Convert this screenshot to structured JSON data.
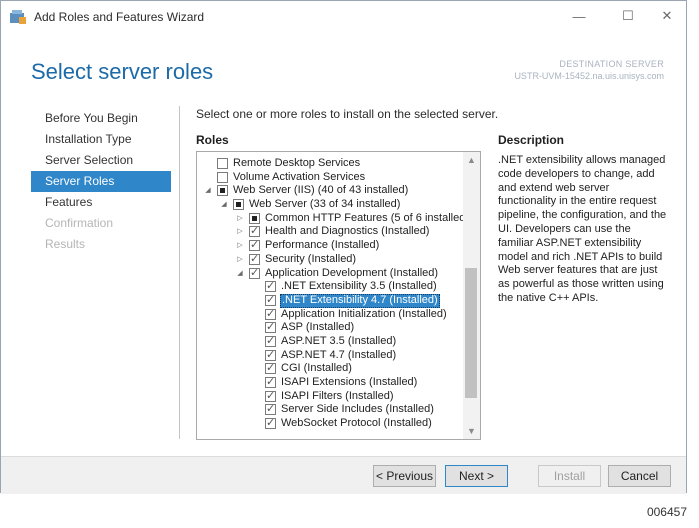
{
  "window": {
    "title": "Add Roles and Features Wizard",
    "controls": {
      "minimize": "—",
      "maximize": "☐",
      "close": "✕"
    }
  },
  "header": {
    "page_title": "Select server roles",
    "destination_label": "DESTINATION SERVER",
    "destination_server": "USTR-UVM-15452.na.uis.unisys.com"
  },
  "nav": {
    "items": [
      {
        "label": "Before You Begin",
        "state": "normal"
      },
      {
        "label": "Installation Type",
        "state": "normal"
      },
      {
        "label": "Server Selection",
        "state": "normal"
      },
      {
        "label": "Server Roles",
        "state": "active"
      },
      {
        "label": "Features",
        "state": "normal"
      },
      {
        "label": "Confirmation",
        "state": "disabled"
      },
      {
        "label": "Results",
        "state": "disabled"
      }
    ]
  },
  "main": {
    "instruction": "Select one or more roles to install on the selected server.",
    "roles_label": "Roles",
    "roles": [
      {
        "label": "Remote Desktop Services",
        "level": 0,
        "expander": "none",
        "check": "unchecked",
        "selected": false
      },
      {
        "label": "Volume Activation Services",
        "level": 0,
        "expander": "none",
        "check": "unchecked",
        "selected": false
      },
      {
        "label": "Web Server (IIS) (40 of 43 installed)",
        "level": 0,
        "expander": "expanded",
        "check": "partial",
        "selected": false
      },
      {
        "label": "Web Server (33 of 34 installed)",
        "level": 1,
        "expander": "expanded",
        "check": "partial",
        "selected": false
      },
      {
        "label": "Common HTTP Features (5 of 6 installed)",
        "level": 2,
        "expander": "collapsed",
        "check": "partial",
        "selected": false
      },
      {
        "label": "Health and Diagnostics (Installed)",
        "level": 2,
        "expander": "collapsed",
        "check": "checked",
        "selected": false
      },
      {
        "label": "Performance (Installed)",
        "level": 2,
        "expander": "collapsed",
        "check": "checked",
        "selected": false
      },
      {
        "label": "Security (Installed)",
        "level": 2,
        "expander": "collapsed",
        "check": "checked",
        "selected": false
      },
      {
        "label": "Application Development (Installed)",
        "level": 2,
        "expander": "expanded",
        "check": "checked",
        "selected": false
      },
      {
        "label": ".NET Extensibility 3.5 (Installed)",
        "level": 3,
        "expander": "none",
        "check": "checked",
        "selected": false
      },
      {
        "label": ".NET Extensibility 4.7 (Installed)",
        "level": 3,
        "expander": "none",
        "check": "checked",
        "selected": true
      },
      {
        "label": "Application Initialization (Installed)",
        "level": 3,
        "expander": "none",
        "check": "checked",
        "selected": false
      },
      {
        "label": "ASP (Installed)",
        "level": 3,
        "expander": "none",
        "check": "checked",
        "selected": false
      },
      {
        "label": "ASP.NET 3.5 (Installed)",
        "level": 3,
        "expander": "none",
        "check": "checked",
        "selected": false
      },
      {
        "label": "ASP.NET 4.7 (Installed)",
        "level": 3,
        "expander": "none",
        "check": "checked",
        "selected": false
      },
      {
        "label": "CGI (Installed)",
        "level": 3,
        "expander": "none",
        "check": "checked",
        "selected": false
      },
      {
        "label": "ISAPI Extensions (Installed)",
        "level": 3,
        "expander": "none",
        "check": "checked",
        "selected": false
      },
      {
        "label": "ISAPI Filters (Installed)",
        "level": 3,
        "expander": "none",
        "check": "checked",
        "selected": false
      },
      {
        "label": "Server Side Includes (Installed)",
        "level": 3,
        "expander": "none",
        "check": "checked",
        "selected": false
      },
      {
        "label": "WebSocket Protocol (Installed)",
        "level": 3,
        "expander": "none",
        "check": "checked",
        "selected": false
      }
    ],
    "description_label": "Description",
    "description_text": ".NET extensibility allows managed code developers to change, add and extend web server functionality in the entire request pipeline, the configuration, and the UI. Developers can use the familiar ASP.NET extensibility model and rich .NET APIs to build Web server features that are just as powerful as those written using the native C++ APIs."
  },
  "footer": {
    "previous": "< Previous",
    "next": "Next >",
    "install": "Install",
    "cancel": "Cancel"
  },
  "page_code": "006457",
  "colors": {
    "accent": "#2f86c8",
    "title_blue": "#1c6aa8"
  }
}
